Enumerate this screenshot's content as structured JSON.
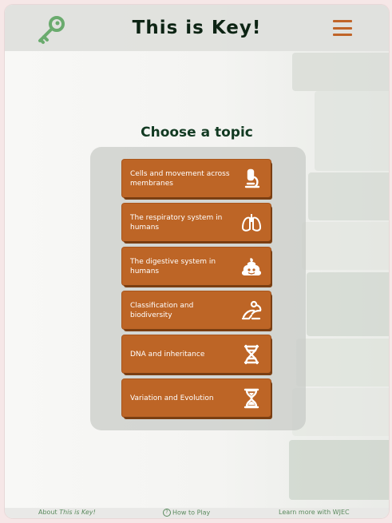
{
  "header": {
    "title": "This is Key!",
    "logo_icon": "key-icon",
    "menu_icon": "hamburger-menu-icon"
  },
  "main": {
    "heading": "Choose a topic",
    "topics": [
      {
        "label": "Cells and movement across membranes",
        "icon": "microscope-icon"
      },
      {
        "label": "The respiratory system in humans",
        "icon": "lungs-icon"
      },
      {
        "label": "The digestive system in humans",
        "icon": "poop-icon"
      },
      {
        "label": "Classification and biodiversity",
        "icon": "frog-icon"
      },
      {
        "label": "DNA and inheritance",
        "icon": "dna-icon"
      },
      {
        "label": "Variation and Evolution",
        "icon": "hourglass-icon"
      }
    ]
  },
  "footer": {
    "about_prefix": "About",
    "about_app": "This is Key!",
    "how_to_play": "How to Play",
    "learn_more": "Learn more with WJEC"
  },
  "colors": {
    "accent": "#bd6526",
    "title": "#0d2414",
    "heading": "#123a22",
    "footer_link": "#5a8a5e",
    "key_icon": "#6aab6e"
  }
}
